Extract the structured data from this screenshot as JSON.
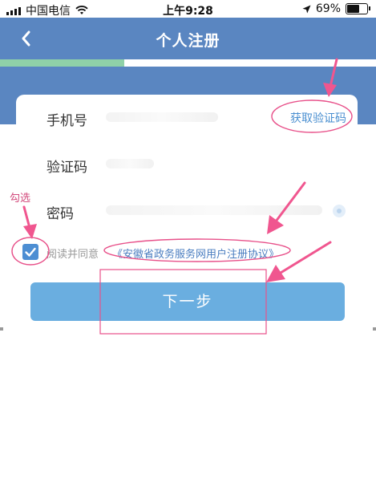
{
  "status_bar": {
    "carrier": "中国电信",
    "time": "上午9:28",
    "battery_percent": "69%",
    "battery_level": 0.69
  },
  "nav": {
    "title": "个人注册",
    "back_icon": "chevron-left-icon"
  },
  "progress": {
    "value": 0.33,
    "color": "#8fd1a8"
  },
  "form": {
    "phone_label": "手机号",
    "code_label": "验证码",
    "get_code_label": "获取验证码",
    "password_label": "密码"
  },
  "agreement": {
    "prefix": "阅读并同意",
    "link": "《安徽省政务服务网用户注册协议》",
    "checked": true
  },
  "next_button": {
    "label": "下一步"
  },
  "annotation": {
    "check_hint": "勾选",
    "color": "#e8518a"
  },
  "colors": {
    "primary": "#5a86c1",
    "button": "#6aaee0",
    "link": "#4a8fd0"
  }
}
